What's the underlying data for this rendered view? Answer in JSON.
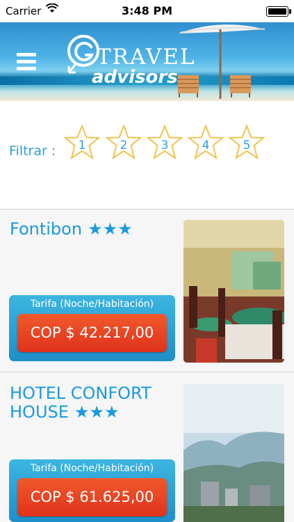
{
  "status_bar": {
    "carrier": "Carrier",
    "time": "3:48 PM"
  },
  "header": {
    "logo_travel": "TRAVEL",
    "logo_advisors": "advisors"
  },
  "filter": {
    "label": "Filtrar :",
    "stars": [
      "1",
      "2",
      "3",
      "4",
      "5"
    ]
  },
  "hotels": [
    {
      "name": "Fontibon",
      "stars": "★★★",
      "rate_label": "Tarifa (Noche/Habitación)",
      "price": "COP $ 42.217,00"
    },
    {
      "name": "HOTEL CONFORT HOUSE",
      "stars": "★★★",
      "rate_label": "Tarifa (Noche/Habitación)",
      "price": "COP $ 61.625,00"
    }
  ],
  "colors": {
    "accent": "#29a0e0",
    "price_button": "#e63c22",
    "rate_box": "#2fa6d8"
  }
}
